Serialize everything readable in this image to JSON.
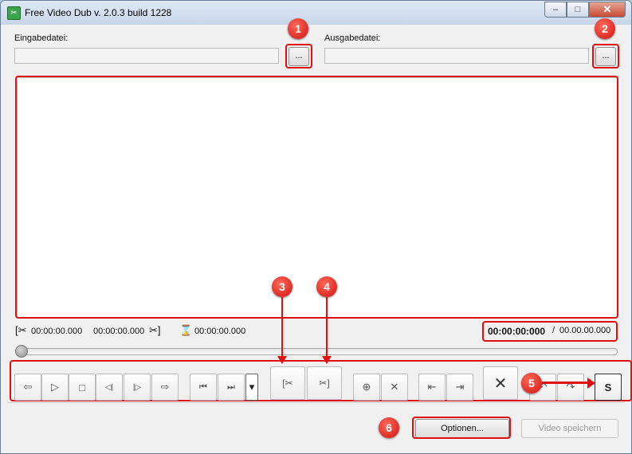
{
  "window": {
    "title": "Free Video Dub  v. 2.0.3 build 1228",
    "app_icon": "app-icon",
    "minimize": "–",
    "maximize": "□",
    "close": "✕"
  },
  "input": {
    "label": "Eingabedatei:",
    "value": "",
    "browse_label": "..."
  },
  "output": {
    "label": "Ausgabedatei:",
    "value": "",
    "browse_label": "..."
  },
  "times": {
    "cut_start": "00:00:00.000",
    "cut_end": "00:00:00.000",
    "marker": "00:00:00.000",
    "current": "00:00:00:000",
    "separator": "/",
    "total": "00.00.00.000"
  },
  "slider": {
    "position": 0
  },
  "toolbar": {
    "prev": "⇦",
    "play": "▷",
    "stop": "□",
    "step_back": "◁|",
    "step_fwd": "|▷",
    "next": "⇨",
    "seek_start": "⏮",
    "seek_end": "⏭",
    "dropdown": "▾",
    "mark_start": "[✂",
    "mark_end": "✂]",
    "sel_a": "⊕",
    "sel_b": "✕",
    "go_prev": "⇤",
    "go_next": "⇥",
    "delete": "✕",
    "undo": "↶",
    "redo": "↷",
    "save_sel": "S"
  },
  "badges": {
    "b1": "1",
    "b2": "2",
    "b3": "3",
    "b4": "4",
    "b5": "5",
    "b6": "6"
  },
  "buttons": {
    "options": "Optionen...",
    "save_video": "Video speichern"
  },
  "colors": {
    "annotation_red": "#e01010",
    "window_bg": "#f0f0f0"
  }
}
